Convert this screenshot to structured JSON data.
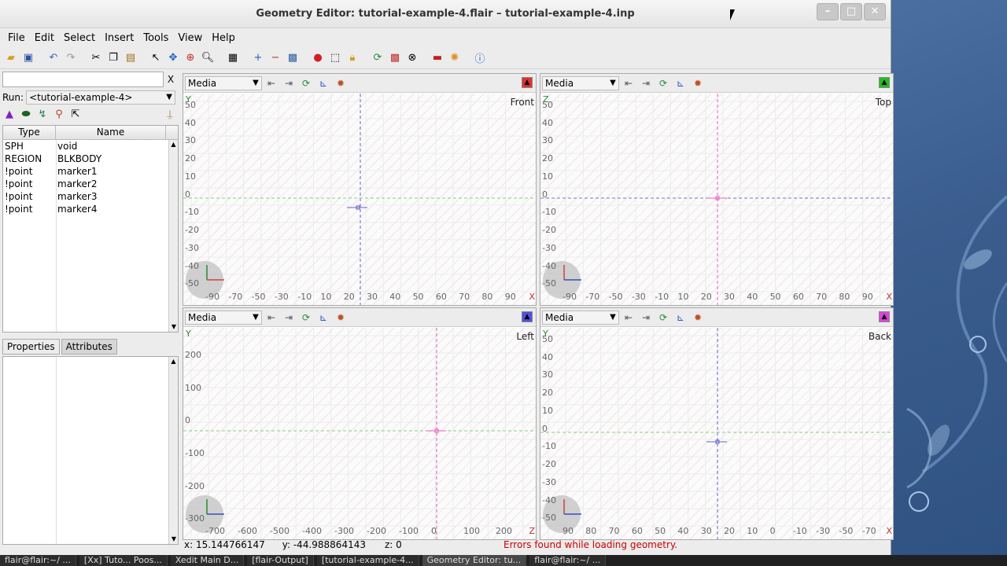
{
  "window": {
    "title": "Geometry Editor: tutorial-example-4.flair – tutorial-example-4.inp"
  },
  "menu": [
    "File",
    "Edit",
    "Select",
    "Insert",
    "Tools",
    "View",
    "Help"
  ],
  "left": {
    "search_value": "",
    "clear_label": "X",
    "run_label": "Run:",
    "run_value": "<tutorial-example-4>",
    "table_headers": {
      "type": "Type",
      "name": "Name"
    },
    "rows": [
      {
        "type": "SPH",
        "name": "void"
      },
      {
        "type": "REGION",
        "name": "BLKBODY"
      },
      {
        "type": "!point",
        "name": "marker1"
      },
      {
        "type": "!point",
        "name": "marker2"
      },
      {
        "type": "!point",
        "name": "marker3"
      },
      {
        "type": "!point",
        "name": "marker4"
      }
    ],
    "tabs": {
      "properties": "Properties",
      "attributes": "Attributes"
    }
  },
  "viewports": {
    "front": {
      "media": "Media",
      "label": "Front",
      "indicator_color": "#e03030",
      "xticks": [
        "-90",
        "-70",
        "-50",
        "-30",
        "-10",
        "10",
        "20",
        "30",
        "40",
        "50",
        "60",
        "70",
        "80",
        "90"
      ],
      "yticks": [
        "50",
        "40",
        "30",
        "20",
        "10",
        "0",
        "-10",
        "-20",
        "-30",
        "-40",
        "-50"
      ]
    },
    "top": {
      "media": "Media",
      "label": "Top",
      "indicator_color": "#20c020",
      "xticks": [
        "-90",
        "-70",
        "-50",
        "-30",
        "-10",
        "10",
        "20",
        "30",
        "40",
        "50",
        "60",
        "70",
        "80",
        "90"
      ],
      "yticks": [
        "50",
        "40",
        "30",
        "20",
        "10",
        "0",
        "-10",
        "-20",
        "-30",
        "-40",
        "-50"
      ]
    },
    "left": {
      "media": "Media",
      "label": "Left",
      "indicator_color": "#5050e0",
      "xticks": [
        "-700",
        "-600",
        "-500",
        "-400",
        "-300",
        "-200",
        "-100",
        "0",
        "100",
        "200"
      ],
      "yticks": [
        "200",
        "100",
        "0",
        "-100",
        "-200",
        "-300"
      ]
    },
    "back": {
      "media": "Media",
      "label": "Back",
      "indicator_color": "#e040e0",
      "xticks": [
        "90",
        "80",
        "70",
        "60",
        "50",
        "40",
        "30",
        "20",
        "10",
        "0",
        "-10",
        "-30",
        "-50",
        "-70"
      ],
      "yticks": [
        "50",
        "40",
        "30",
        "20",
        "10",
        "0",
        "-10",
        "-20",
        "-30",
        "-40",
        "-50"
      ]
    }
  },
  "status": {
    "x": "x: 15.144766147",
    "y": "y: -44.988864143",
    "z": "z: 0",
    "message": "Errors found while loading geometry."
  },
  "taskbar": [
    "flair@flair:~/ ...",
    "[Xx] Tuto... Poos...",
    "Xedit Main D...",
    "[flair-Output]",
    "[tutorial-example-4...",
    "Geometry Editor: tu...",
    "flair@flair:~/ ..."
  ]
}
